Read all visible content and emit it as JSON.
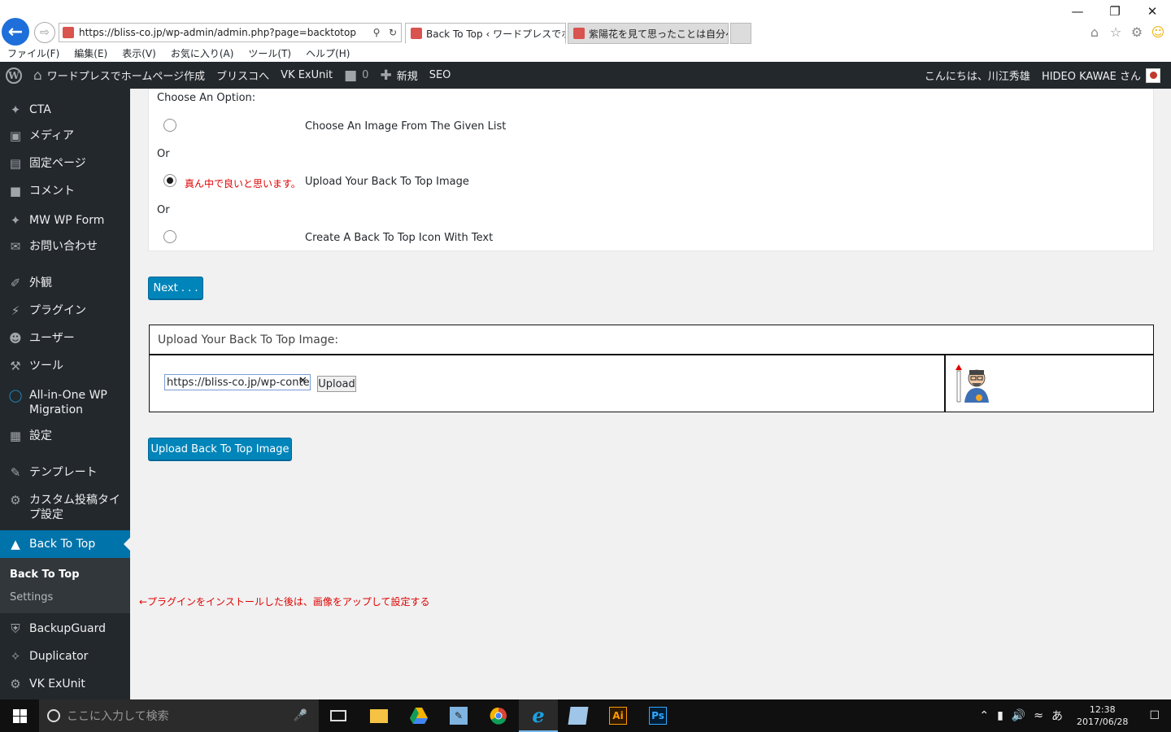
{
  "browser": {
    "url": "https://bliss-co.jp/wp-admin/admin.php?page=backtotop",
    "tabs": [
      {
        "label": "Back To Top ‹ ワードプレスでホ...",
        "active": true,
        "close": "×"
      },
      {
        "label": "紫陽花を見て思ったことは自分へ...",
        "active": false
      }
    ],
    "menu": [
      "ファイル(F)",
      "編集(E)",
      "表示(V)",
      "お気に入り(A)",
      "ツール(T)",
      "ヘルプ(H)"
    ],
    "window_controls": {
      "minimize": "—",
      "maximize": "❐",
      "close": "✕"
    }
  },
  "adminbar": {
    "site_name": "ワードプレスでホームページ作成",
    "link_bliss": "ブリスコへ",
    "vk_exunit": "VK ExUnit",
    "comments_count": "0",
    "new_label": "新規",
    "seo_label": "SEO",
    "greeting": "こんにちは、川江秀雄",
    "user": "HIDEO KAWAE さん"
  },
  "sidebar": {
    "items": [
      {
        "label": "CTA",
        "icon": "pin-icon"
      },
      {
        "label": "メディア",
        "icon": "media-icon"
      },
      {
        "label": "固定ページ",
        "icon": "pages-icon"
      },
      {
        "label": "コメント",
        "icon": "comment-icon"
      },
      {
        "label": "MW WP Form",
        "icon": "pin-icon"
      },
      {
        "label": "お問い合わせ",
        "icon": "mail-icon"
      },
      {
        "label": "外観",
        "icon": "brush-icon"
      },
      {
        "label": "プラグイン",
        "icon": "plugin-icon"
      },
      {
        "label": "ユーザー",
        "icon": "user-icon"
      },
      {
        "label": "ツール",
        "icon": "wrench-icon"
      },
      {
        "label": "All-in-One WP Migration",
        "icon": "migration-icon"
      },
      {
        "label": "設定",
        "icon": "settings-icon"
      },
      {
        "label": "テンプレート",
        "icon": "pencil-icon"
      },
      {
        "label": "カスタム投稿タイプ設定",
        "icon": "gear-icon"
      },
      {
        "label": "Back To Top",
        "icon": "backtotop-icon"
      },
      {
        "label": "BackupGuard",
        "icon": "shield-icon"
      },
      {
        "label": "Duplicator",
        "icon": "share-icon"
      },
      {
        "label": "VK ExUnit",
        "icon": "gear-icon"
      }
    ],
    "submenu": {
      "current": "Back To Top",
      "settings": "Settings"
    }
  },
  "main": {
    "choose_label": "Choose An Option:",
    "or_label": "Or",
    "options": [
      {
        "label": "Choose An Image From The Given List",
        "checked": false
      },
      {
        "label": "Upload Your Back To Top Image",
        "checked": true
      },
      {
        "label": "Create A Back To Top Icon With Text",
        "checked": false
      }
    ],
    "red_note_option": "真ん中で良いと思います。",
    "next_button": "Next . . .",
    "upload_heading": "Upload Your Back To Top Image:",
    "url_value": "https://bliss-co.jp/wp-content/uploads/",
    "upload_button": "Upload",
    "submit_button": "Upload Back To Top Image",
    "red_note_bottom": "←プラグインをインストールした後は、画像をアップして設定する"
  },
  "taskbar": {
    "search_placeholder": "ここに入力して検索",
    "ime": "あ",
    "time": "12:38",
    "date": "2017/06/28",
    "apps": [
      "task-view",
      "file-explorer",
      "google-drive",
      "paint-app",
      "chrome",
      "internet-explorer",
      "notepad-app",
      "illustrator",
      "photoshop"
    ],
    "illustrator_label": "Ai",
    "photoshop_label": "Ps"
  },
  "colors": {
    "wp_dark": "#23282d",
    "wp_blue": "#0085ba",
    "note_red": "#e00000"
  }
}
